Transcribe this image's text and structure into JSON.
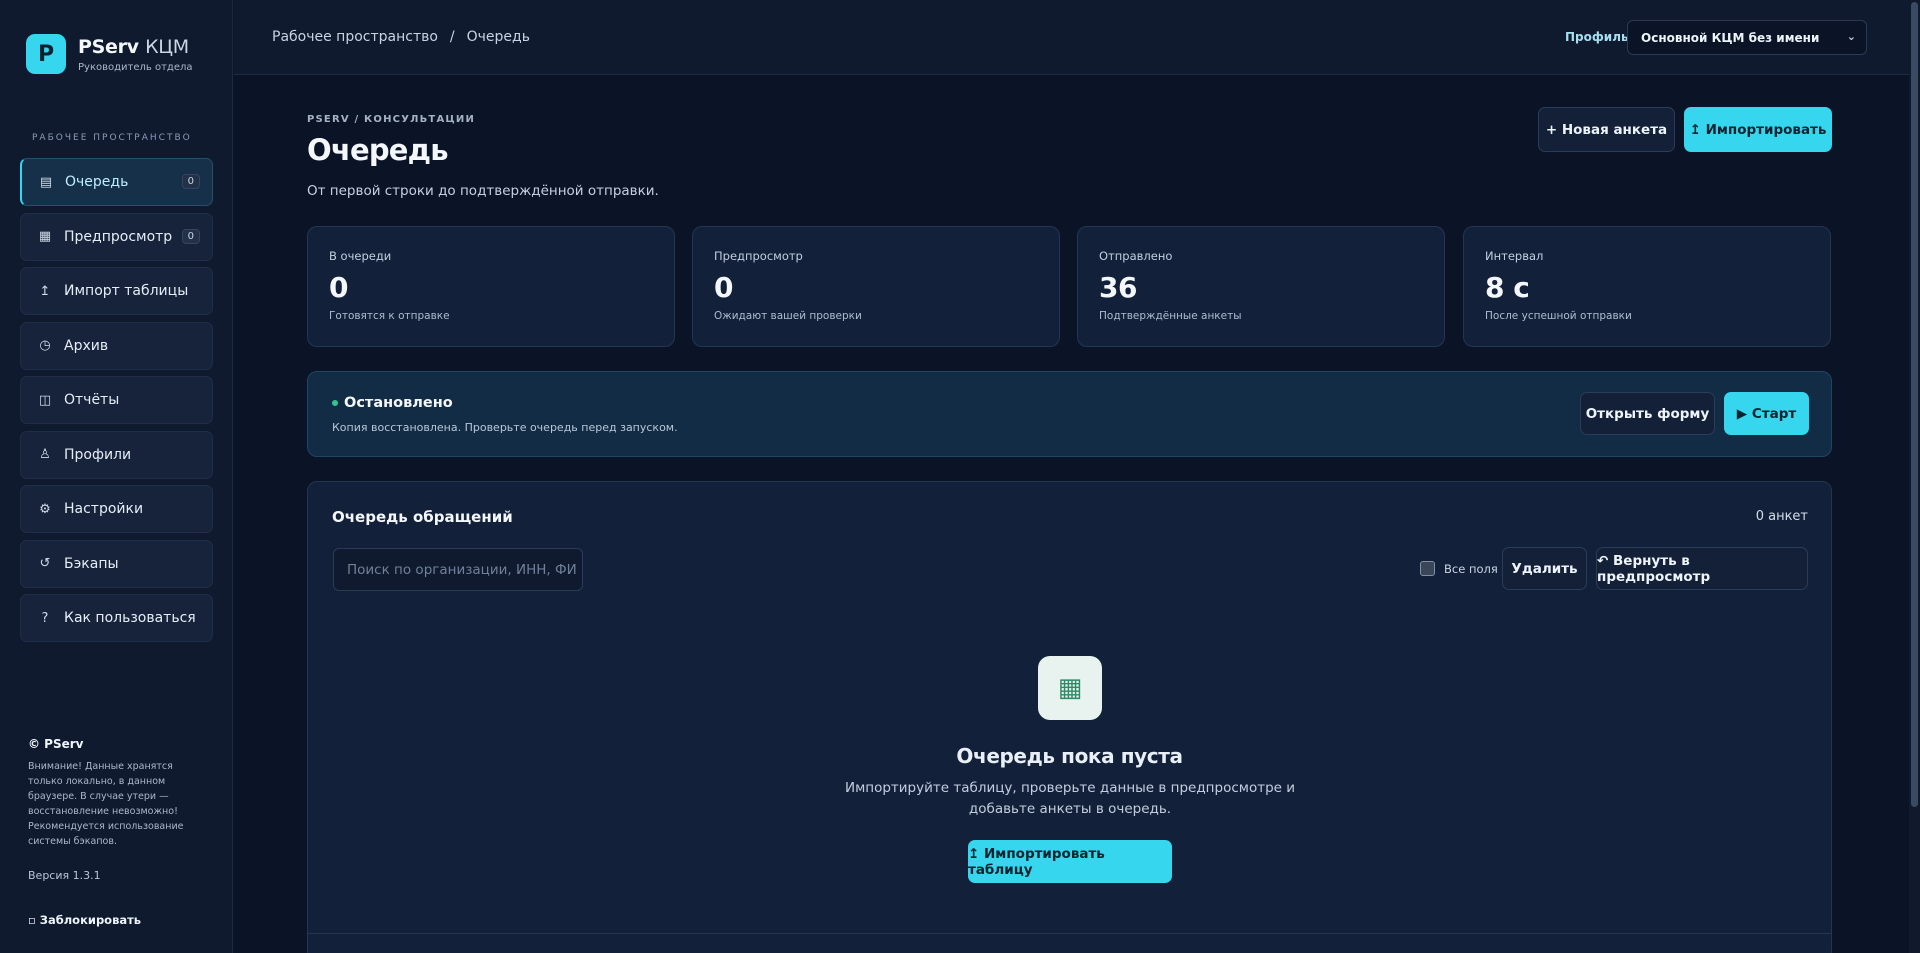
{
  "brand": {
    "logo_letter": "P",
    "name_bold": "PServ",
    "name_light": "КЦМ",
    "role": "Руководитель отдела"
  },
  "sidebar": {
    "section_label": "РАБОЧЕЕ ПРОСТРАНСТВО",
    "items": [
      {
        "label": "Очередь",
        "icon": "list-icon",
        "glyph": "▤",
        "badge": "0",
        "active": true
      },
      {
        "label": "Предпросмотр",
        "icon": "table-icon",
        "glyph": "▦",
        "badge": "0"
      },
      {
        "label": "Импорт таблицы",
        "icon": "upload-arrow-icon",
        "glyph": "↥"
      },
      {
        "label": "Архив",
        "icon": "clock-icon",
        "glyph": "◷"
      },
      {
        "label": "Отчёты",
        "icon": "book-icon",
        "glyph": "◫"
      },
      {
        "label": "Профили",
        "icon": "person-icon",
        "glyph": "♙"
      },
      {
        "label": "Настройки",
        "icon": "gear-icon",
        "glyph": "⚙"
      },
      {
        "label": "Бэкапы",
        "icon": "restore-icon",
        "glyph": "↺"
      },
      {
        "label": "Как пользоваться",
        "icon": "question-icon",
        "glyph": "?"
      }
    ],
    "footer": {
      "copyright": "© PServ",
      "warning": "Внимание! Данные хранятся только локально, в данном браузере. В случае утери — восстановление невозможно! Рекомендуется использование системы бэкапов.",
      "version": "Версия 1.3.1",
      "lock": "▫ Заблокировать"
    }
  },
  "topbar": {
    "breadcrumb": [
      "Рабочее пространство",
      "Очередь"
    ],
    "breadcrumb_sep": "/",
    "profile_label": "Профиль",
    "profile_value": "Основной КЦМ без имени"
  },
  "header": {
    "eyebrow": "PSERV / КОНСУЛЬТАЦИИ",
    "title": "Очередь",
    "subtitle": "От первой строки до подтверждённой отправки.",
    "new_button": "+  Новая анкета",
    "import_button": "↥ Импортировать"
  },
  "stats": [
    {
      "label": "В очереди",
      "value": "0",
      "note": "Готовятся к отправке"
    },
    {
      "label": "Предпросмотр",
      "value": "0",
      "note": "Ожидают вашей проверки"
    },
    {
      "label": "Отправлено",
      "value": "36",
      "note": "Подтверждённые анкеты"
    },
    {
      "label": "Интервал",
      "value": "8 с",
      "note": "После успешной отправки"
    }
  ],
  "status": {
    "title": "Остановлено",
    "description": "Копия восстановлена. Проверьте очередь перед запуском.",
    "open_form_button": "Открыть форму",
    "start_button": "▶ Старт",
    "dot_color": "#35c48f"
  },
  "queue": {
    "title": "Очередь обращений",
    "count": "0 анкет",
    "search_placeholder": "Поиск по организации, ИНН, ФИ",
    "all_fields_label": "Все поля",
    "delete_button": "Удалить",
    "return_button": "↶ Вернуть в предпросмотр",
    "empty_title": "Очередь пока пуста",
    "empty_description": "Импортируйте таблицу, проверьте данные в предпросмотре и добавьте анкеты в очередь.",
    "import_table_button": "↥ Импортировать таблицу"
  },
  "colors": {
    "accent": "#35d6ee",
    "background": "#0b1326",
    "sidebar": "#0f1a2e"
  }
}
